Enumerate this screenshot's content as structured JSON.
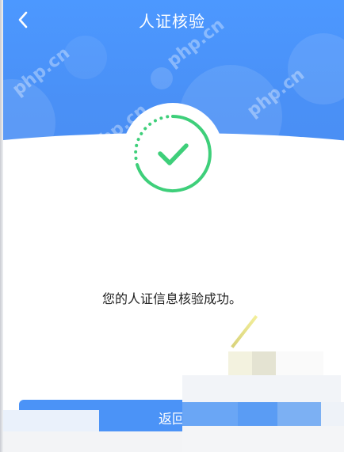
{
  "header": {
    "title": "人证核验",
    "back_icon": "chevron-left-icon"
  },
  "watermark_text": "php.cn",
  "badge": {
    "icon": "check-icon",
    "color": "#3ecf7a"
  },
  "message": "您的人证信息核验成功。",
  "return_button": {
    "label": "返回"
  },
  "colors": {
    "header_blue": "#4a90f6",
    "button_blue": "#4b93f7",
    "success_green": "#3ecf7a"
  }
}
